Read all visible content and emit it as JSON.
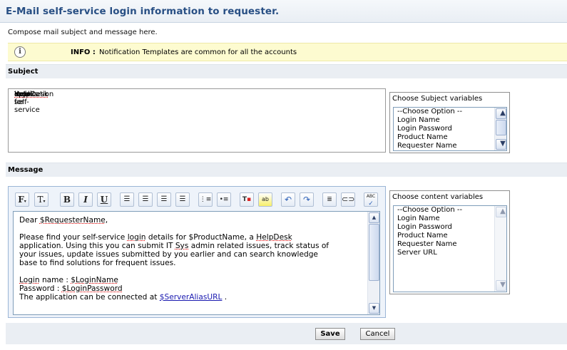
{
  "title": "E-Mail self-service login information to requester.",
  "compose_text": "Compose mail subject and message here.",
  "info": {
    "label": "INFO :",
    "text": "Notification Templates are common for all the accounts"
  },
  "subject": {
    "section_label": "Subject",
    "value_parts": [
      "Your self-service ",
      "login",
      " details for ",
      "HelpDesk",
      " application"
    ],
    "variables_caption": "Choose Subject variables",
    "variables": [
      "--Choose Option --",
      "Login Name",
      "Login Password",
      "Product Name",
      "Requester Name"
    ]
  },
  "message": {
    "section_label": "Message",
    "variables_caption": "Choose content variables",
    "variables": [
      "--Choose Option --",
      "Login Name",
      "Login Password",
      "Product Name",
      "Requester Name",
      "Server URL"
    ],
    "toolbar": {
      "font": "F",
      "size": "T",
      "bold": "B",
      "italic": "I",
      "underline": "U",
      "spell": "ABC"
    },
    "body": {
      "greeting": [
        "Dear ",
        "$RequesterName",
        ","
      ],
      "para1_l1": [
        "Please find your self-service ",
        "login",
        " details for $ProductName, a ",
        "HelpDesk"
      ],
      "para1_l2": [
        "application. Using this you can submit IT ",
        "Sys",
        " admin related issues, track status of"
      ],
      "para1_l3": "your issues, update issues submitted by you earlier and can search knowledge",
      "para1_l4": "base to find solutions for frequent issues.",
      "login_line": [
        "Login",
        " name : ",
        "$LoginName"
      ],
      "password_line": [
        "Password : ",
        "$LoginPassword"
      ],
      "connect_line": [
        "The application can be connected at ",
        "$ServerAliasURL",
        " ."
      ]
    }
  },
  "buttons": {
    "save": "Save",
    "cancel": "Cancel"
  }
}
